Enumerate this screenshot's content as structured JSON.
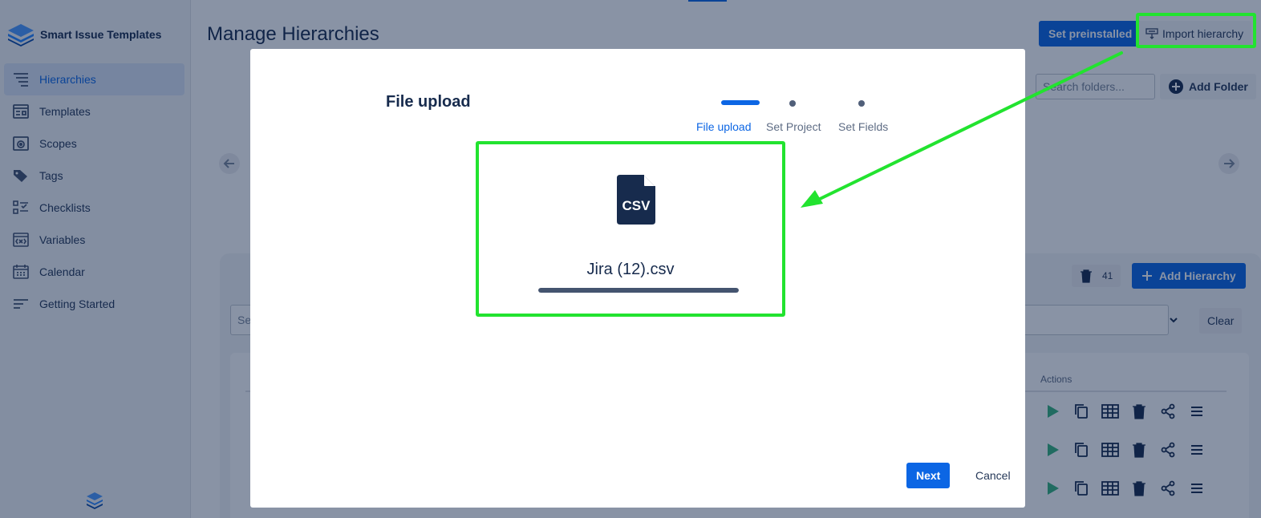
{
  "app": {
    "name": "Smart Issue Templates",
    "colors": {
      "accent": "#0c66e4",
      "highlight": "#22e32f",
      "overlay": "rgba(9,30,66,0.48)"
    }
  },
  "sidebar": {
    "items": [
      {
        "label": "Hierarchies",
        "icon": "hierarchy-icon",
        "active": true
      },
      {
        "label": "Templates",
        "icon": "template-icon",
        "active": false
      },
      {
        "label": "Scopes",
        "icon": "scope-icon",
        "active": false
      },
      {
        "label": "Tags",
        "icon": "tag-icon",
        "active": false
      },
      {
        "label": "Checklists",
        "icon": "checklist-icon",
        "active": false
      },
      {
        "label": "Variables",
        "icon": "variable-icon",
        "active": false
      },
      {
        "label": "Calendar",
        "icon": "calendar-icon",
        "active": false
      },
      {
        "label": "Getting Started",
        "icon": "getting-started-icon",
        "active": false
      }
    ]
  },
  "header": {
    "title": "Manage Hierarchies",
    "set_preinstalled_label": "Set preinstalled",
    "import_label": "Import hierarchy"
  },
  "folders": {
    "search_placeholder": "Search folders...",
    "add_folder_label": "Add Folder"
  },
  "list": {
    "trash_count": "41",
    "add_hierarchy_label": "Add Hierarchy",
    "filter_placeholder": "Se",
    "clear_label": "Clear",
    "actions_header": "Actions"
  },
  "modal": {
    "title": "File upload",
    "steps": [
      {
        "label": "File upload",
        "active": true
      },
      {
        "label": "Set Project",
        "active": false
      },
      {
        "label": "Set Fields",
        "active": false
      }
    ],
    "file_type": "CSV",
    "file_name": "Jira (12).csv",
    "upload_progress": 1.0,
    "next_label": "Next",
    "cancel_label": "Cancel"
  }
}
